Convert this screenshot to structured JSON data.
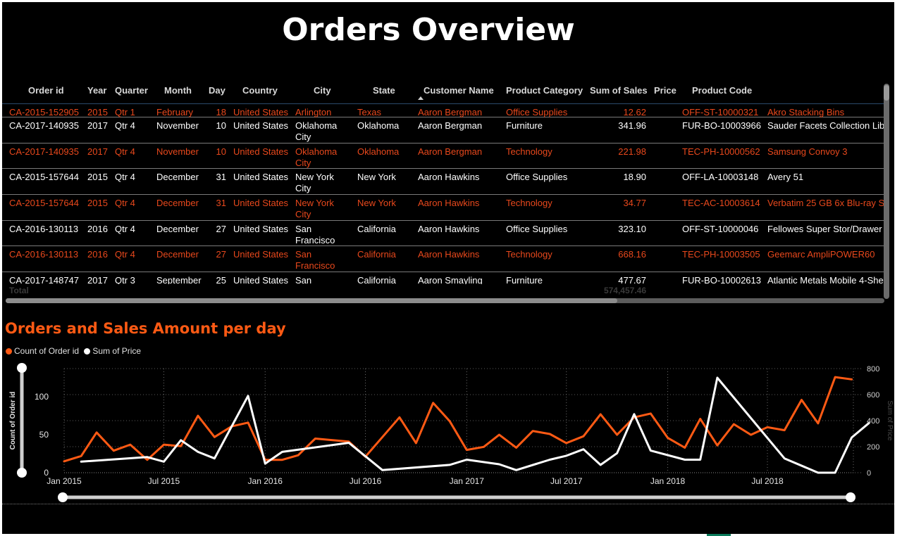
{
  "title": "Orders Overview",
  "table": {
    "columns": [
      "Order id",
      "Year",
      "Quarter",
      "Month",
      "Day",
      "Country",
      "City",
      "State",
      "Customer Name",
      "Product Category",
      "Sum of Sales",
      "Price",
      "Product Code"
    ],
    "rows": [
      {
        "order_id": "CA-2015-152905",
        "year": "2015",
        "quarter": "Qtr 1",
        "month": "February",
        "day": "18",
        "country": "United States",
        "city": "Arlington",
        "state": "Texas",
        "customer": "Aaron Bergman",
        "category": "Office Supplies",
        "sales": "12.62",
        "code": "OFF-ST-10000321",
        "product": "Akro Stacking Bins",
        "highlight": true
      },
      {
        "order_id": "CA-2017-140935",
        "year": "2017",
        "quarter": "Qtr 4",
        "month": "November",
        "day": "10",
        "country": "United States",
        "city": "Oklahoma City",
        "state": "Oklahoma",
        "customer": "Aaron Bergman",
        "category": "Furniture",
        "sales": "341.96",
        "code": "FUR-BO-10003966",
        "product": "Sauder Facets Collection Libr",
        "highlight": false
      },
      {
        "order_id": "CA-2017-140935",
        "year": "2017",
        "quarter": "Qtr 4",
        "month": "November",
        "day": "10",
        "country": "United States",
        "city": "Oklahoma City",
        "state": "Oklahoma",
        "customer": "Aaron Bergman",
        "category": "Technology",
        "sales": "221.98",
        "code": "TEC-PH-10000562",
        "product": "Samsung Convoy 3",
        "highlight": true
      },
      {
        "order_id": "CA-2015-157644",
        "year": "2015",
        "quarter": "Qtr 4",
        "month": "December",
        "day": "31",
        "country": "United States",
        "city": "New York City",
        "state": "New York",
        "customer": "Aaron Hawkins",
        "category": "Office Supplies",
        "sales": "18.90",
        "code": "OFF-LA-10003148",
        "product": "Avery 51",
        "highlight": false
      },
      {
        "order_id": "CA-2015-157644",
        "year": "2015",
        "quarter": "Qtr 4",
        "month": "December",
        "day": "31",
        "country": "United States",
        "city": "New York City",
        "state": "New York",
        "customer": "Aaron Hawkins",
        "category": "Technology",
        "sales": "34.77",
        "code": "TEC-AC-10003614",
        "product": "Verbatim 25 GB 6x Blu-ray Si",
        "highlight": true
      },
      {
        "order_id": "CA-2016-130113",
        "year": "2016",
        "quarter": "Qtr 4",
        "month": "December",
        "day": "27",
        "country": "United States",
        "city": "San Francisco",
        "state": "California",
        "customer": "Aaron Hawkins",
        "category": "Office Supplies",
        "sales": "323.10",
        "code": "OFF-ST-10000046",
        "product": "Fellowes Super Stor/Drawer",
        "highlight": false
      },
      {
        "order_id": "CA-2016-130113",
        "year": "2016",
        "quarter": "Qtr 4",
        "month": "December",
        "day": "27",
        "country": "United States",
        "city": "San Francisco",
        "state": "California",
        "customer": "Aaron Hawkins",
        "category": "Technology",
        "sales": "668.16",
        "code": "TEC-PH-10003505",
        "product": "Geemarc AmpliPOWER60",
        "highlight": true
      },
      {
        "order_id": "CA-2017-148747",
        "year": "2017",
        "quarter": "Qtr 3",
        "month": "September",
        "day": "25",
        "country": "United States",
        "city": "San",
        "state": "California",
        "customer": "Aaron Smayling",
        "category": "Furniture",
        "sales": "477.67",
        "code": "FUR-BO-10002613",
        "product": "Atlantic Metals Mobile 4-She",
        "highlight": false
      }
    ],
    "total_label": "Total",
    "total_sales": "574,457.46"
  },
  "chart": {
    "title": "Orders and Sales Amount per day",
    "legend": [
      {
        "name": "Count of Order id",
        "color": "#ff5a14"
      },
      {
        "name": "Sum of Price",
        "color": "#ffffff"
      }
    ]
  },
  "chart_data": {
    "type": "line",
    "title": "Orders and Sales Amount per day",
    "ylabel": "Count of Order id",
    "y2label": "Sum of Price",
    "x_ticks": [
      "Jan 2015",
      "Jul 2015",
      "Jan 2016",
      "Jul 2016",
      "Jan 2017",
      "Jul 2017",
      "Jan 2018",
      "Jul 2018"
    ],
    "y_ticks": [
      0,
      50,
      100
    ],
    "y2_ticks": [
      0,
      200,
      400,
      600,
      800
    ],
    "ylim": [
      0,
      140
    ],
    "y2lim": [
      0,
      800
    ],
    "grid": true,
    "series": [
      {
        "name": "Count of Order id",
        "color": "#ff5a14",
        "axis": "left",
        "points": [
          [
            "2015-01-01",
            15
          ],
          [
            "2015-02-01",
            22
          ],
          [
            "2015-03-01",
            53
          ],
          [
            "2015-04-01",
            29
          ],
          [
            "2015-05-01",
            37
          ],
          [
            "2015-06-01",
            17
          ],
          [
            "2015-07-01",
            37
          ],
          [
            "2015-08-01",
            35
          ],
          [
            "2015-09-01",
            75
          ],
          [
            "2015-10-01",
            47
          ],
          [
            "2015-11-01",
            61
          ],
          [
            "2015-12-01",
            66
          ],
          [
            "2016-01-01",
            17
          ],
          [
            "2016-02-01",
            17
          ],
          [
            "2016-03-01",
            23
          ],
          [
            "2016-04-01",
            45
          ],
          [
            "2016-05-01",
            43
          ],
          [
            "2016-06-01",
            41
          ],
          [
            "2016-07-01",
            21
          ],
          [
            "2016-08-01",
            47
          ],
          [
            "2016-09-01",
            73
          ],
          [
            "2016-10-01",
            39
          ],
          [
            "2016-11-01",
            92
          ],
          [
            "2016-12-01",
            68
          ],
          [
            "2017-01-01",
            30
          ],
          [
            "2017-02-01",
            34
          ],
          [
            "2017-03-01",
            50
          ],
          [
            "2017-04-01",
            33
          ],
          [
            "2017-05-01",
            55
          ],
          [
            "2017-06-01",
            51
          ],
          [
            "2017-07-01",
            39
          ],
          [
            "2017-08-01",
            48
          ],
          [
            "2017-09-01",
            77
          ],
          [
            "2017-10-01",
            50
          ],
          [
            "2017-11-01",
            73
          ],
          [
            "2017-12-01",
            78
          ],
          [
            "2018-01-01",
            46
          ],
          [
            "2018-02-01",
            33
          ],
          [
            "2018-03-01",
            71
          ],
          [
            "2018-04-01",
            36
          ],
          [
            "2018-05-01",
            64
          ],
          [
            "2018-06-01",
            50
          ],
          [
            "2018-07-01",
            60
          ],
          [
            "2018-08-01",
            56
          ],
          [
            "2018-09-01",
            96
          ],
          [
            "2018-10-01",
            65
          ],
          [
            "2018-11-01",
            126
          ],
          [
            "2018-12-01",
            123
          ]
        ]
      },
      {
        "name": "Sum of Price",
        "color": "#ffffff",
        "axis": "right",
        "points": [
          [
            "2015-02-01",
            85
          ],
          [
            "2015-06-01",
            120
          ],
          [
            "2015-07-01",
            85
          ],
          [
            "2015-08-01",
            250
          ],
          [
            "2015-09-01",
            160
          ],
          [
            "2015-10-01",
            110
          ],
          [
            "2015-12-01",
            590
          ],
          [
            "2016-01-01",
            70
          ],
          [
            "2016-02-01",
            160
          ],
          [
            "2016-06-01",
            230
          ],
          [
            "2016-08-01",
            20
          ],
          [
            "2016-12-01",
            60
          ],
          [
            "2017-01-01",
            100
          ],
          [
            "2017-03-01",
            65
          ],
          [
            "2017-04-01",
            20
          ],
          [
            "2017-06-01",
            100
          ],
          [
            "2017-07-01",
            130
          ],
          [
            "2017-08-01",
            180
          ],
          [
            "2017-09-01",
            60
          ],
          [
            "2017-10-01",
            150
          ],
          [
            "2017-11-01",
            450
          ],
          [
            "2017-12-01",
            170
          ],
          [
            "2018-02-01",
            100
          ],
          [
            "2018-03-01",
            100
          ],
          [
            "2018-04-01",
            730
          ],
          [
            "2018-08-01",
            110
          ],
          [
            "2018-10-01",
            0
          ],
          [
            "2018-11-01",
            0
          ],
          [
            "2018-12-01",
            270
          ],
          [
            "2019-01-01",
            380
          ]
        ]
      }
    ]
  }
}
